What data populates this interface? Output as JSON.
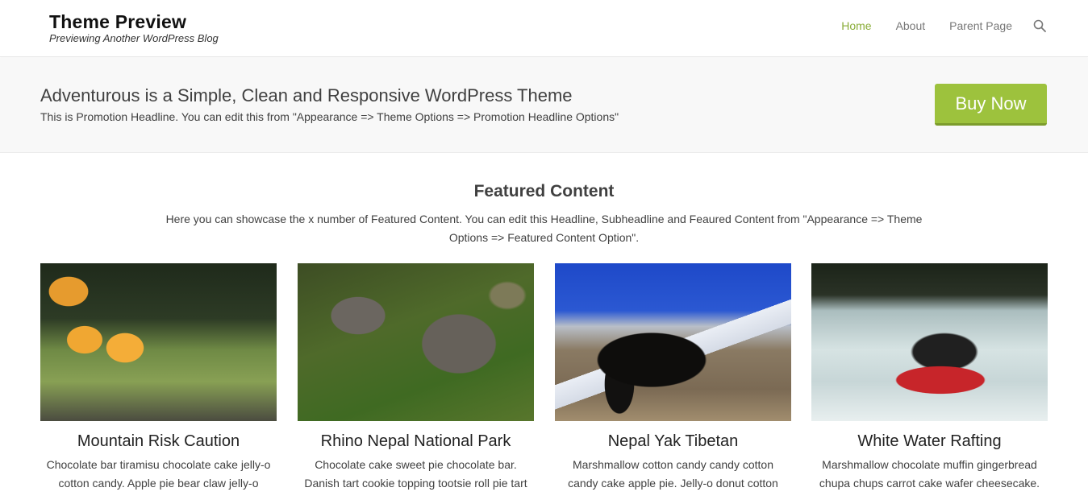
{
  "header": {
    "site_title": "Theme Preview",
    "site_description": "Previewing Another WordPress Blog",
    "nav": [
      {
        "label": "Home",
        "active": true
      },
      {
        "label": "About",
        "active": false
      },
      {
        "label": "Parent Page",
        "active": false
      }
    ],
    "search_icon": "search-icon",
    "accent_color": "#8aad39"
  },
  "promotion": {
    "title": "Adventurous is a Simple, Clean and Responsive WordPress Theme",
    "subtitle": "This is Promotion Headline. You can edit this from \"Appearance => Theme Options => Promotion Headline Options\"",
    "button_label": "Buy Now",
    "button_color": "#9dc23d"
  },
  "featured": {
    "title": "Featured Content",
    "subtitle": "Here you can showcase the x number of Featured Content. You can edit this Headline, Subheadline and Feaured Content from \"Appearance => Theme Options => Featured Content Option\".",
    "items": [
      {
        "title": "Mountain Risk Caution",
        "excerpt": "Chocolate bar tiramisu chocolate cake jelly-o cotton candy. Apple pie bear claw jelly-o",
        "image": "helmets-rope-bridge"
      },
      {
        "title": "Rhino Nepal National Park",
        "excerpt": "Chocolate cake sweet pie chocolate bar. Danish tart cookie topping tootsie roll pie tart",
        "image": "rhinos-grazing"
      },
      {
        "title": "Nepal Yak Tibetan",
        "excerpt": "Marshmallow cotton candy candy cotton candy cake apple pie. Jelly-o donut cotton",
        "image": "yak-mountain"
      },
      {
        "title": "White Water Rafting",
        "excerpt": "Marshmallow chocolate muffin gingerbread chupa chups carrot cake wafer cheesecake.",
        "image": "rafting-river"
      }
    ]
  }
}
